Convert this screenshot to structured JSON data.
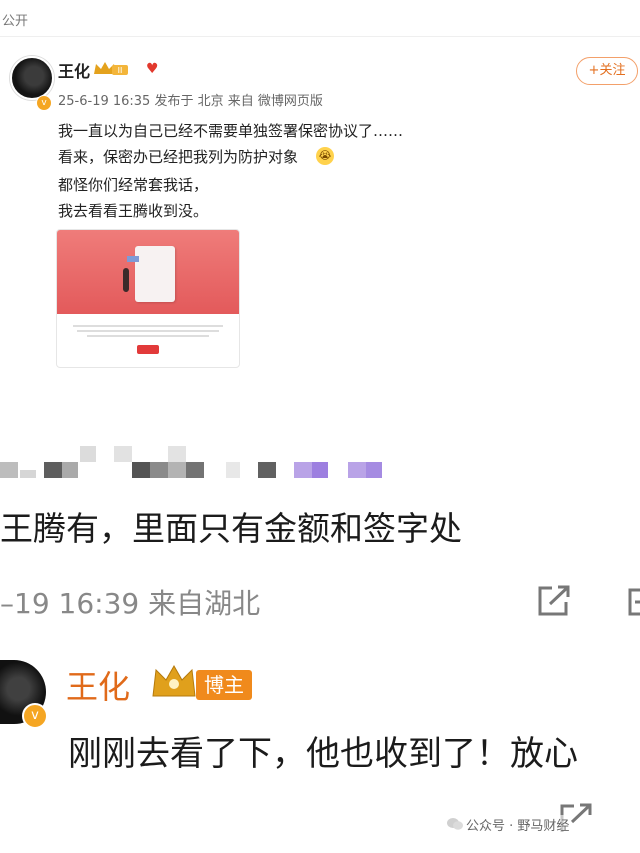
{
  "post": {
    "visibility": "公开",
    "username": "王化",
    "verified_mark": "v",
    "meta": "25-6-19 16:35  发布于 北京  来自 微博网页版",
    "follow_label": "+关注",
    "lines": [
      "我一直以为自己已经不需要单独签署保密协议了……",
      "看来，保密办已经把我列为防护对象",
      "都怪你们经常套我话，",
      "我去看看王腾收到没。"
    ],
    "emoji": "crying-face-emoji",
    "crown_level": "II"
  },
  "comment": {
    "text": "王腾有，里面只有金额和签字处",
    "meta": "–19 16:39  来自湖北"
  },
  "reply": {
    "username": "王化",
    "badge": "博主",
    "text": "刚刚去看了下，他也收到了！放心",
    "verified_mark": "v"
  },
  "watermark": "公众号 · 野马财经",
  "colors": {
    "accent_orange": "#e06a1a",
    "badge_orange": "#f08a1c",
    "card_red": "#e35a5b"
  }
}
